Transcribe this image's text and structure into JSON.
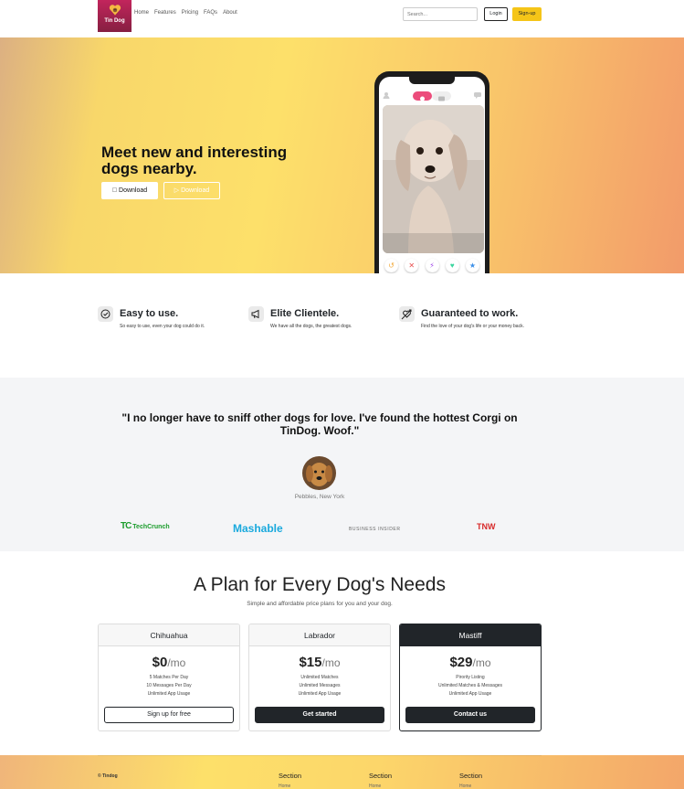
{
  "nav": {
    "logo_text": "Tin Dog",
    "links": [
      "Home",
      "Features",
      "Pricing",
      "FAQs",
      "About"
    ],
    "search_placeholder": "Search...",
    "login_label": "Login",
    "signup_label": "Sign-up"
  },
  "hero": {
    "title": "Meet new and interesting dogs nearby.",
    "download_primary": "Download",
    "download_secondary": "Download",
    "accent_color": "#ec4c7b"
  },
  "features": [
    {
      "icon": "check-circle-icon",
      "title": "Easy to use.",
      "text": "So easy to use, even your dog could do it."
    },
    {
      "icon": "bullhorn-icon",
      "title": "Elite Clientele.",
      "text": "We have all the dogs, the greatest dogs."
    },
    {
      "icon": "heart-arrow-icon",
      "title": "Guaranteed to work.",
      "text": "Find the love of your dog's life or your money back."
    }
  ],
  "testimonial": {
    "quote": "\"I no longer have to sniff other dogs for love. I've found the hottest Corgi on TinDog. Woof.\"",
    "name": "Pebbles, New York"
  },
  "press": {
    "techcrunch": "TechCrunch",
    "mashable": "Mashable",
    "business_insider": "BUSINESS INSIDER",
    "tnw": "TNW"
  },
  "pricing": {
    "title": "A Plan for Every Dog's Needs",
    "subtitle": "Simple and affordable price plans for you and your dog.",
    "plans": [
      {
        "name": "Chihuahua",
        "price": "$0",
        "per": "/mo",
        "features": [
          "5 Matches Per Day",
          "10 Messages Per Day",
          "Unlimited App Usage"
        ],
        "button": "Sign up for free"
      },
      {
        "name": "Labrador",
        "price": "$15",
        "per": "/mo",
        "features": [
          "Unlimited Matches",
          "Unlimited Messages",
          "Unlimited App Usage"
        ],
        "button": "Get started"
      },
      {
        "name": "Mastiff",
        "price": "$29",
        "per": "/mo",
        "features": [
          "Pirority Listing",
          "Unlimited Matches & Messages",
          "Unlimited App Usage"
        ],
        "button": "Contact us"
      }
    ]
  },
  "footer": {
    "copyright": "© Tindog",
    "columns": [
      {
        "heading": "Section",
        "link": "Home"
      },
      {
        "heading": "Section",
        "link": "Home"
      },
      {
        "heading": "Section",
        "link": "Home"
      }
    ]
  }
}
